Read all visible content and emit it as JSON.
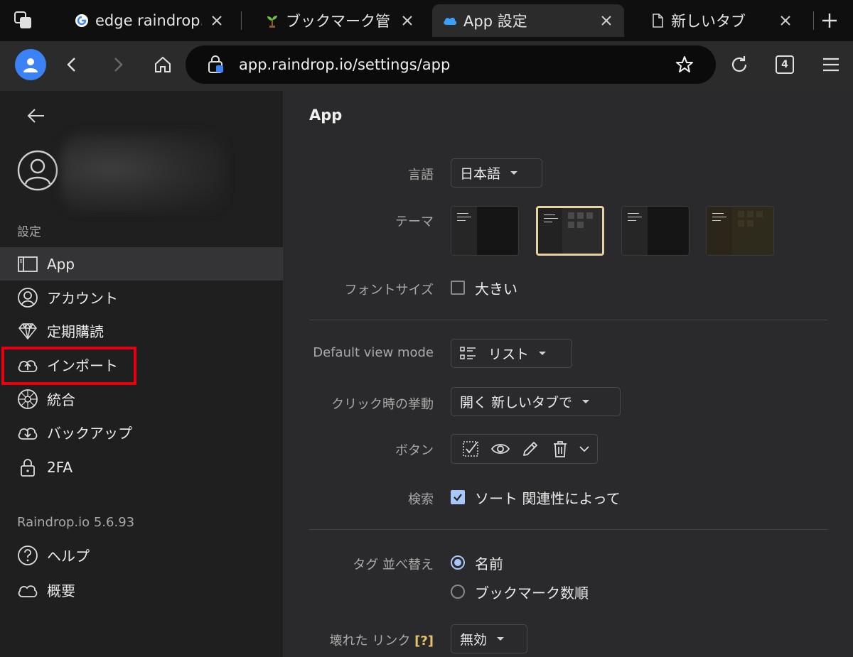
{
  "tabs": [
    {
      "title": "edge raindrop.io",
      "favicon": "google-icon",
      "active": false
    },
    {
      "title": "ブックマーク管",
      "favicon": "sprout-icon",
      "active": false
    },
    {
      "title": "App 設定",
      "favicon": "cloud-icon",
      "active": true
    },
    {
      "title": "新しいタブ",
      "favicon": "page-icon",
      "active": false
    }
  ],
  "toolbar": {
    "url": "app.raindrop.io/settings/app",
    "tab_count": "4"
  },
  "sidebar": {
    "section_title": "設定",
    "items": [
      {
        "label": "App",
        "icon": "app-panel-icon",
        "active": true
      },
      {
        "label": "アカウント",
        "icon": "user-circle-icon"
      },
      {
        "label": "定期購読",
        "icon": "diamond-icon"
      },
      {
        "label": "インポート",
        "icon": "cloud-upload-icon"
      },
      {
        "label": "統合",
        "icon": "integration-icon"
      },
      {
        "label": "バックアップ",
        "icon": "cloud-download-icon"
      },
      {
        "label": "2FA",
        "icon": "lock-icon"
      }
    ],
    "version": "Raindrop.io 5.6.93",
    "footer_items": [
      {
        "label": "ヘルプ",
        "icon": "help-icon"
      },
      {
        "label": "概要",
        "icon": "cloud-outline-icon"
      }
    ]
  },
  "main": {
    "title": "App",
    "language": {
      "label": "言語",
      "value": "日本語"
    },
    "theme": {
      "label": "テーマ"
    },
    "font_size": {
      "label": "フォントサイズ",
      "option": "大きい",
      "checked": false
    },
    "view_mode": {
      "label": "Default view mode",
      "value": "リスト"
    },
    "click_behavior": {
      "label": "クリック時の挙動",
      "value": "開く 新しいタブで"
    },
    "buttons": {
      "label": "ボタン"
    },
    "search": {
      "label": "検索",
      "option": "ソート 関連性によって",
      "checked": true
    },
    "tag_sort": {
      "label": "タグ 並べ替え",
      "options": [
        "名前",
        "ブックマーク数順"
      ],
      "selected": 0
    },
    "broken_links": {
      "label": "壊れた リンク",
      "help": "[?]",
      "value": "無効"
    }
  },
  "colors": {
    "accent": "#a8c7fa",
    "highlight_box": "#e60012",
    "selected_theme_border": "#e6d3a3"
  }
}
